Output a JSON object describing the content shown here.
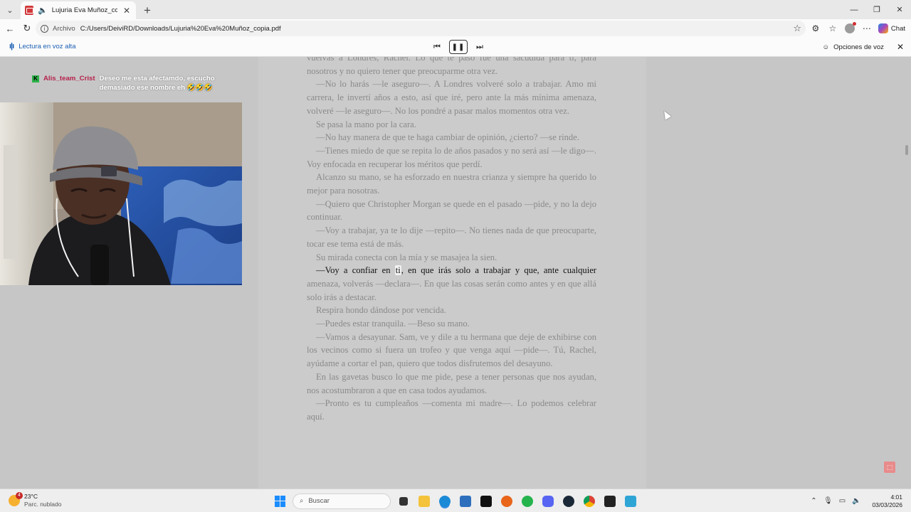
{
  "browser": {
    "tab": {
      "title": "Lujuria Eva Muñoz_copia.pdf"
    },
    "address": {
      "scheme_label": "Archivo",
      "url": "C:/Users/DeiviRD/Downloads/Lujuria%20Eva%20Muñoz_copia.pdf"
    },
    "copilot_label": "Chat"
  },
  "read_aloud": {
    "label": "Lectura en voz alta",
    "voice_options": "Opciones de voz"
  },
  "document": {
    "paragraphs": [
      "vuelvas a Londres, Rachel. Lo que te pasó fue una sacudida para ti, para nosotros y no quiero tener que preocuparme otra vez.",
      "—No lo harás —le aseguro—. A Londres volveré solo a trabajar. Amo mi carrera, le invertí años a esto, así que iré, pero ante la más mínima amenaza, volveré —le aseguro—. No los pondré a pasar malos momentos otra vez.",
      "Se pasa la mano por la cara.",
      "—No hay manera de que te haga cambiar de opinión, ¿cierto? —se rinde.",
      "—Tienes miedo de que se repita lo de años pasados y no será así —le digo—. Voy enfocada en recuperar los méritos que perdí.",
      "Alcanzo su mano, se ha esforzado en nuestra crianza y siempre ha querido lo mejor para nosotras.",
      "—Quiero que Christopher Morgan se quede en el pasado —pide, y no la dejo continuar.",
      "—Voy a trabajar, ya te lo dije —repito—. No tienes nada de que preocuparte, tocar ese tema está de más.",
      "Su mirada conecta con la mía y se masajea la sien."
    ],
    "highlight": {
      "before": "—Voy a confiar en ",
      "word": "ti",
      "after": ", en que irás solo a trabajar y que, ante cualquier",
      "rest": "amenaza, volverás —declara—. En que las cosas serán como antes y en que allá solo irás a destacar."
    },
    "paragraphs_after": [
      "Respira hondo dándose por vencida.",
      "—Puedes estar tranquila. —Beso su mano.",
      "—Vamos a desayunar. Sam, ve y dile a tu hermana que deje de exhibirse con los vecinos como si fuera un trofeo y que venga aquí —pide—. Tú, Rachel, ayúdame a cortar el pan, quiero que todos disfrutemos del desayuno.",
      "En las gavetas busco lo que me pide, pese a tener personas que nos ayudan, nos acostumbraron a que en casa todos ayudamos.",
      "—Pronto es tu cumpleaños —comenta mi madre—. Lo podemos celebrar aquí."
    ]
  },
  "overlay": {
    "chat_badge": "K",
    "chat_user": "Alis_team_Crist",
    "chat_message": "Deseo me esta afectamdo, escucho demasiado ese nombre eh 🤣🤣🤣"
  },
  "taskbar": {
    "weather_temp": "23°C",
    "weather_cond": "Parc. nublado",
    "weather_badge": "4",
    "search_placeholder": "Buscar",
    "time": "4:01",
    "date": "03/03/2026"
  },
  "colors": {
    "accent": "#1a5fb4",
    "pdf_red": "#d2383a",
    "page_bg": "#cbcbcb"
  }
}
